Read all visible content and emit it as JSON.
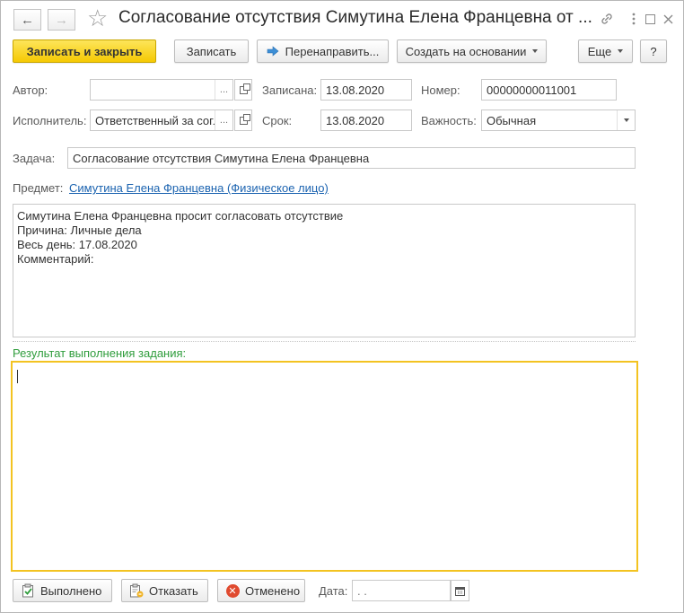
{
  "window": {
    "title": "Согласование отсутствия Симутина Елена Францевна от ...",
    "back": "←",
    "forward": "→",
    "star": "☆",
    "link_icon": "🔗",
    "menu_icon": "⋮",
    "restore_icon": "☐",
    "close_icon": "✕"
  },
  "toolbar": {
    "save_close": "Записать и закрыть",
    "save": "Записать",
    "redirect": "Перенаправить...",
    "create_based": "Создать на основании",
    "more": "Еще",
    "help": "?"
  },
  "form": {
    "author_label": "Автор:",
    "author_value": "",
    "author_dots": "...",
    "recorded_label": "Записана:",
    "recorded_value": "13.08.2020",
    "number_label": "Номер:",
    "number_value": "00000000011001",
    "executor_label": "Исполнитель:",
    "executor_value": "Ответственный за согл",
    "executor_dots": "...",
    "deadline_label": "Срок:",
    "deadline_value": "13.08.2020",
    "importance_label": "Важность:",
    "importance_value": "Обычная",
    "task_label": "Задача:",
    "task_value": "Согласование отсутствия Симутина Елена Францевна",
    "subject_label": "Предмет:",
    "subject_link": "Симутина Елена Францевна (Физическое лицо)",
    "description": "Симутина Елена Францевна просит согласовать отсутствие\nПричина: Личные дела\nВесь день: 17.08.2020\nКомментарий:",
    "result_title": "Результат выполнения задания:",
    "result_value": ""
  },
  "bottom": {
    "done": "Выполнено",
    "refuse": "Отказать",
    "cancelled": "Отменено",
    "date_label": "Дата:",
    "date_value": "  .  ."
  },
  "colors": {
    "primary_button": "#f5c903",
    "result_border": "#f3c321",
    "result_title": "#2e9c3b",
    "link": "#1b63b0"
  }
}
